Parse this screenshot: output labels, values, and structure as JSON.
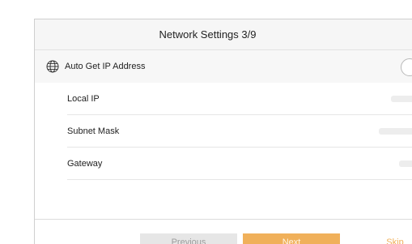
{
  "header": {
    "title": "Network Settings 3/9"
  },
  "settings": {
    "auto_ip": {
      "label": "Auto Get IP Address",
      "icon": "globe-icon",
      "enabled": false
    },
    "fields": [
      {
        "label": "Local IP"
      },
      {
        "label": "Subnet Mask"
      },
      {
        "label": "Gateway"
      }
    ]
  },
  "footer": {
    "previous_label": "Previous",
    "next_label": "Next",
    "skip_label": "Skip"
  },
  "colors": {
    "accent": "#f0b05a",
    "header_bg": "#f6f6f6",
    "prev_bg": "#e6e6e6",
    "prev_text": "#9c9c9c"
  }
}
